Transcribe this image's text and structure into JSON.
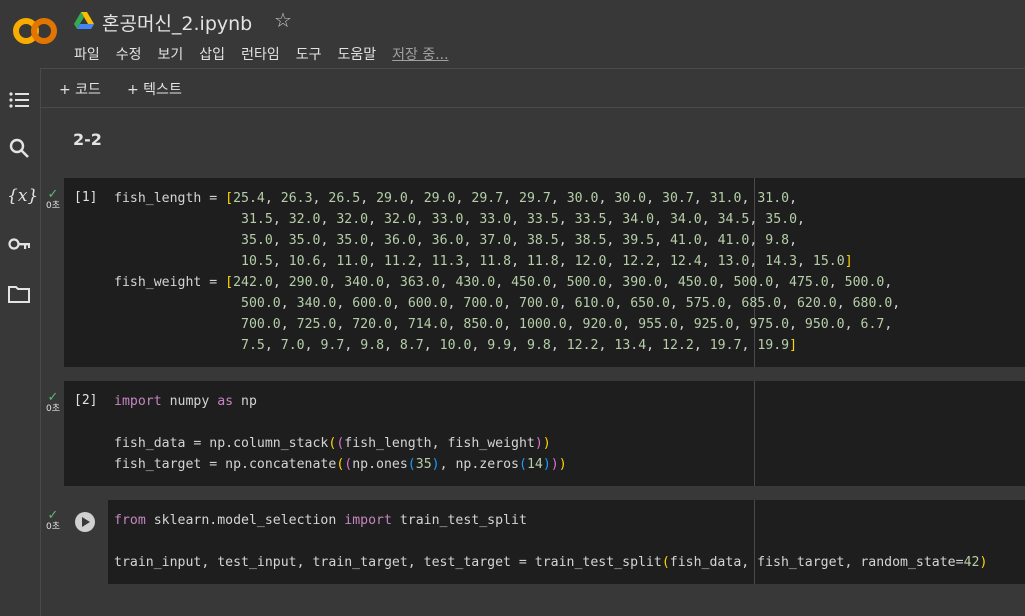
{
  "header": {
    "title": "혼공머신_2.ipynb",
    "star_icon": "star-icon",
    "brand_colors": {
      "orange": "#f9ab00",
      "accent": "#e37400"
    },
    "menu": [
      "파일",
      "수정",
      "보기",
      "삽입",
      "런타임",
      "도구",
      "도움말"
    ],
    "saving_status": "저장 중..."
  },
  "sidebar": {
    "icons": [
      "table-of-contents-icon",
      "search-icon",
      "variables-icon",
      "key-icon",
      "folder-icon"
    ],
    "variables_label": "{x}"
  },
  "toolbar": {
    "add_code": "+ 코드",
    "add_text": "+ 텍스트"
  },
  "notebook": {
    "section_heading": "2-2",
    "cells": [
      {
        "exec_count": "[1]",
        "status_check": "✓",
        "duration": "0초"
      },
      {
        "exec_count": "[2]",
        "status_check": "✓",
        "duration": "0초"
      },
      {
        "exec_count": "",
        "status_check": "✓",
        "duration": "0초"
      }
    ]
  }
}
